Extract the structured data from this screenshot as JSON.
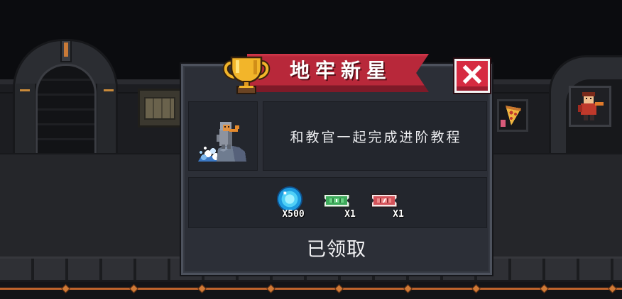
{
  "scene": {
    "colors": {
      "trim": "#c0642c"
    }
  },
  "dialog": {
    "title": "地牢新星",
    "title_icon": "trophy-icon",
    "close_icon": "close-icon",
    "task": {
      "icon": "knight-on-rock-icon",
      "description": "和教官一起完成进阶教程"
    },
    "rewards": [
      {
        "icon": "blue-gem-icon",
        "quantity": "X500"
      },
      {
        "icon": "green-ticket-icon",
        "quantity": "X1"
      },
      {
        "icon": "red-ticket-icon",
        "quantity": "X1"
      }
    ],
    "status": "已领取",
    "colors": {
      "panel": "#2c2f37",
      "inner_panel": "#23262d",
      "banner": "#b8283a",
      "close_button": "#d62b41",
      "trophy": "#f2b52a"
    }
  }
}
